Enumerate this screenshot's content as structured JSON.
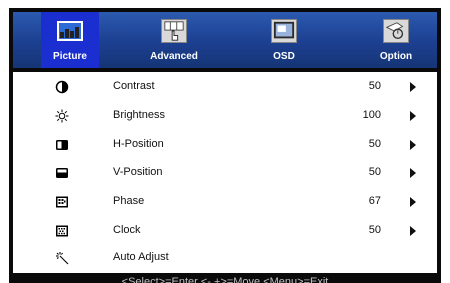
{
  "tabs": [
    {
      "label": "Picture",
      "icon": "picture-icon",
      "selected": true
    },
    {
      "label": "Advanced",
      "icon": "advanced-icon",
      "selected": false
    },
    {
      "label": "OSD",
      "icon": "osd-icon",
      "selected": false
    },
    {
      "label": "Option",
      "icon": "option-icon",
      "selected": false
    }
  ],
  "menu": {
    "items": [
      {
        "label": "Contrast",
        "value": "50",
        "icon": "contrast-icon",
        "has_arrow": true
      },
      {
        "label": "Brightness",
        "value": "100",
        "icon": "brightness-icon",
        "has_arrow": true
      },
      {
        "label": "H-Position",
        "value": "50",
        "icon": "h-position-icon",
        "has_arrow": true
      },
      {
        "label": "V-Position",
        "value": "50",
        "icon": "v-position-icon",
        "has_arrow": true
      },
      {
        "label": "Phase",
        "value": "67",
        "icon": "phase-icon",
        "has_arrow": true
      },
      {
        "label": "Clock",
        "value": "50",
        "icon": "clock-icon",
        "has_arrow": true
      },
      {
        "label": "Auto Adjust",
        "value": "",
        "icon": "auto-adjust-icon",
        "has_arrow": false
      }
    ]
  },
  "status_bar": {
    "text": "<Select>=Enter <- +>=Move <Menu>=Exit"
  },
  "colors": {
    "tab_bar": "#1c3f90",
    "selected_tab": "#1b2fd0",
    "frame": "#0a0a0a"
  }
}
